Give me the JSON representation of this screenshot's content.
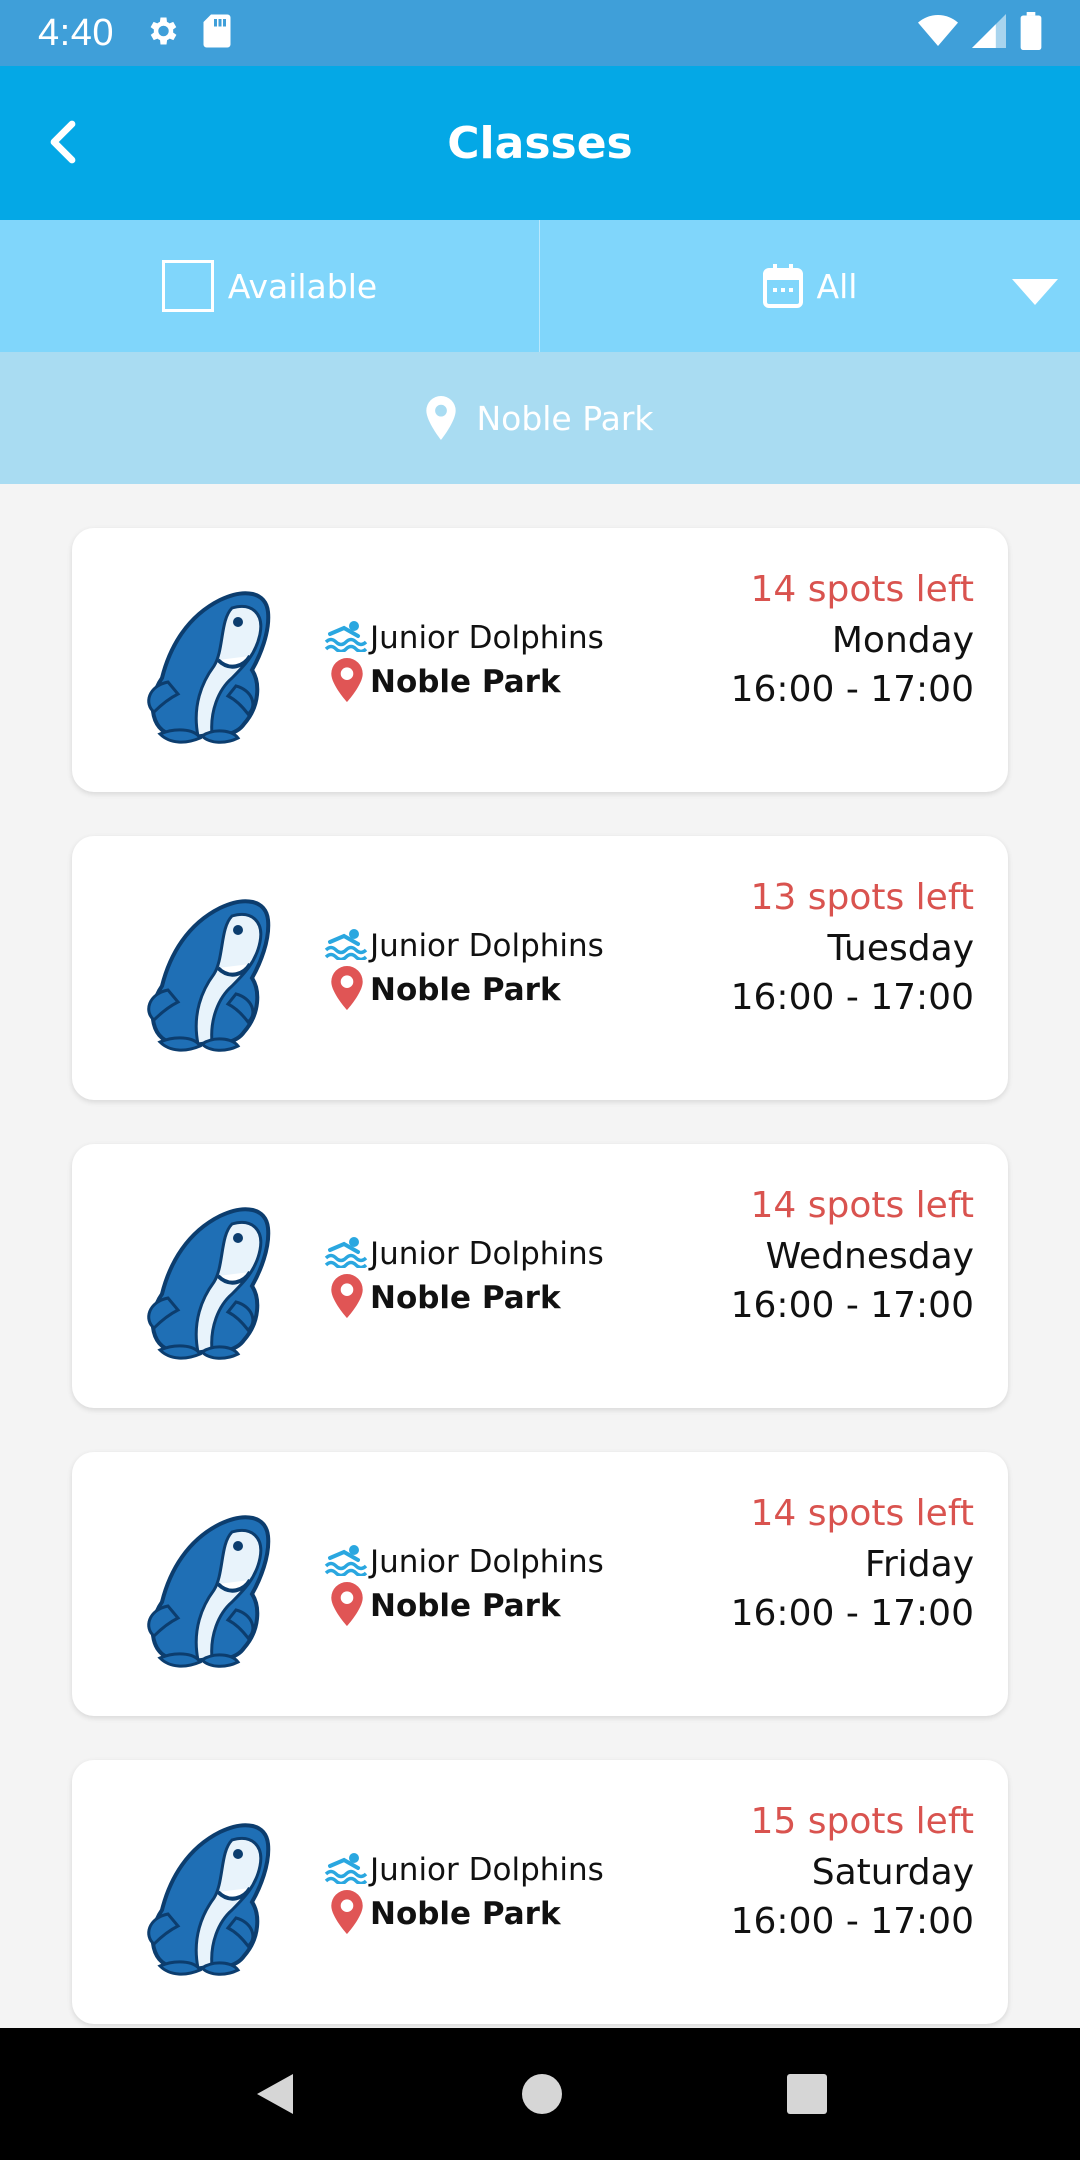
{
  "status_bar": {
    "time": "4:40",
    "icons_left": [
      "gear-icon",
      "sd-card-icon"
    ],
    "icons_right": [
      "wifi-icon",
      "signal-icon",
      "battery-icon"
    ]
  },
  "app_bar": {
    "title": "Classes",
    "back_icon": "chevron-left-icon"
  },
  "filters": {
    "available_label": "Available",
    "available_checked": false,
    "date_label": "All",
    "date_icon": "calendar-icon",
    "dropdown_icon": "caret-down-icon"
  },
  "location_filter": {
    "label": "Noble Park",
    "icon": "location-pin-icon"
  },
  "classes": [
    {
      "name": "Junior Dolphins",
      "location": "Noble Park",
      "spots": "14 spots left",
      "day": "Monday",
      "time": "16:00 - 17:00"
    },
    {
      "name": "Junior Dolphins",
      "location": "Noble Park",
      "spots": "13 spots left",
      "day": "Tuesday",
      "time": "16:00 - 17:00"
    },
    {
      "name": "Junior Dolphins",
      "location": "Noble Park",
      "spots": "14 spots left",
      "day": "Wednesday",
      "time": "16:00 - 17:00"
    },
    {
      "name": "Junior Dolphins",
      "location": "Noble Park",
      "spots": "14 spots left",
      "day": "Friday",
      "time": "16:00 - 17:00"
    },
    {
      "name": "Junior Dolphins",
      "location": "Noble Park",
      "spots": "15 spots left",
      "day": "Saturday",
      "time": "16:00 - 17:00"
    }
  ],
  "colors": {
    "status_bar": "#3f9fd9",
    "app_bar": "#04a8e6",
    "filter_bar": "#80d6fb",
    "location_bar": "#a9dcf2",
    "spots_text": "#d9534f",
    "mascot": "#1f6fb5"
  },
  "nav_bar": {
    "icons": [
      "back-triangle-icon",
      "home-circle-icon",
      "recents-square-icon"
    ]
  }
}
